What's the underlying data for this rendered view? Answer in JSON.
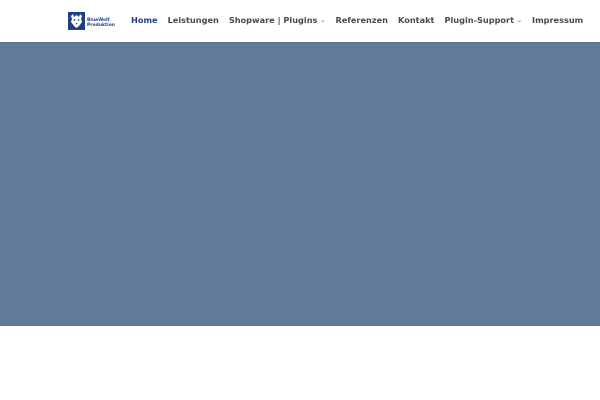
{
  "header": {
    "logo": {
      "line1": "BlueWolf",
      "line2": "Produktion",
      "icon": "wolf-logo-icon",
      "brand_color": "#1f3f86"
    },
    "nav": [
      {
        "label": "Home",
        "active": true
      },
      {
        "label": "Leistungen"
      },
      {
        "label": "Shopware | Plugins",
        "has_dropdown": true
      },
      {
        "label": "Referenzen"
      },
      {
        "label": "Kontakt"
      },
      {
        "label": "Plugin-Support",
        "has_dropdown": true
      },
      {
        "label": "Impressum"
      }
    ],
    "chevron_glyph": "⌄"
  },
  "hero": {
    "background_color": "#5f7a9a"
  }
}
